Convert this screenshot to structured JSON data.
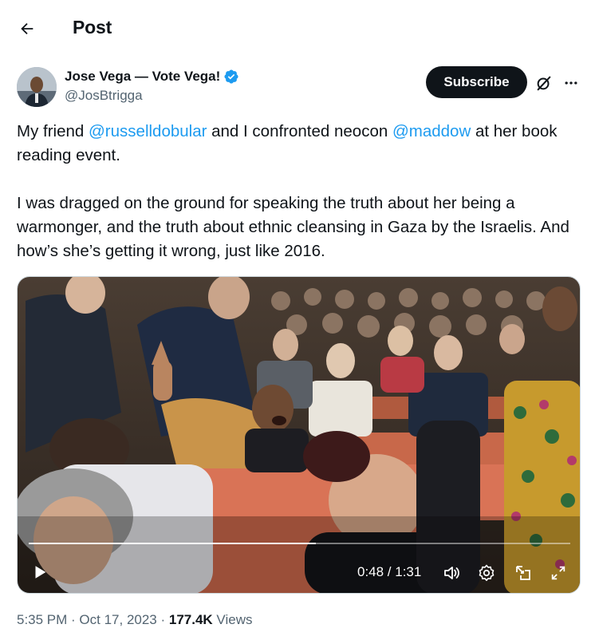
{
  "header": {
    "title": "Post",
    "back_icon": "arrow-left-icon"
  },
  "author": {
    "display_name": "Jose Vega — Vote Vega!",
    "handle": "@JosBtrigga",
    "verified": true,
    "verified_color": "#1d9bf0"
  },
  "actions": {
    "subscribe_label": "Subscribe",
    "grok_icon": "grok-icon",
    "more_icon": "more-icon"
  },
  "tweet": {
    "p1_a": "My friend ",
    "p1_mention1": "@russelldobular",
    "p1_b": " and I confronted neocon ",
    "p1_mention2": "@maddow",
    "p1_c": " at her book reading event.",
    "p2": "I was dragged on the ground for speaking the truth about her being a warmonger, and the truth about ethnic cleansing in Gaza by the Israelis. And how’s she’s getting it wrong, just like 2016."
  },
  "video": {
    "current_time": "0:48",
    "duration": "1:31",
    "time_display": "0:48 / 1:31",
    "progress": 0.53,
    "controls": [
      "play-icon",
      "volume-icon",
      "settings-icon",
      "pip-icon",
      "fullscreen-icon"
    ]
  },
  "meta": {
    "time": "5:35 PM",
    "date": "Oct 17, 2023",
    "separator": " · ",
    "views_count": "177.4K",
    "views_label": " Views"
  },
  "colors": {
    "accent": "#1d9bf0",
    "text": "#0f1419",
    "muted": "#536471",
    "button_bg": "#0f1419"
  }
}
